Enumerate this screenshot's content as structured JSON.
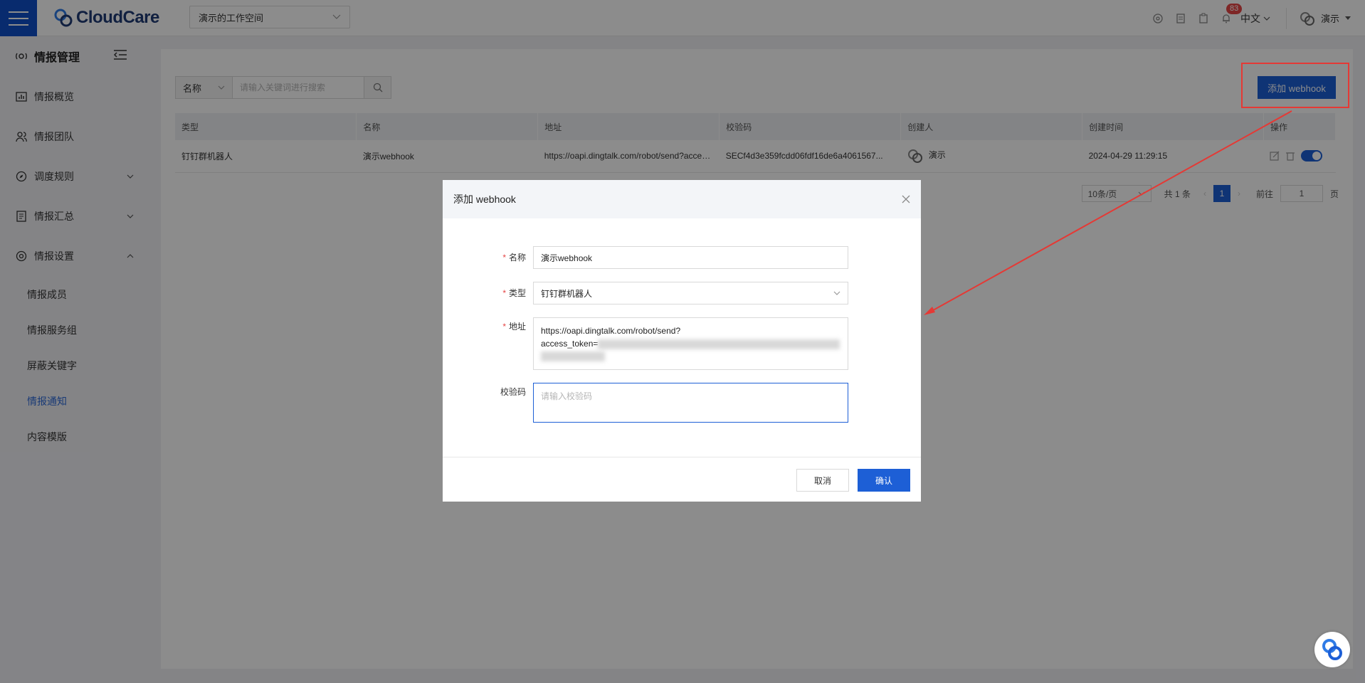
{
  "header": {
    "brand": "CloudCare",
    "workspace": "演示的工作空间",
    "notification_count": "83",
    "language": "中文",
    "user_name": "演示"
  },
  "sidebar": {
    "title": "情报管理",
    "items": [
      {
        "label": "情报概览"
      },
      {
        "label": "情报团队"
      },
      {
        "label": "调度规则"
      },
      {
        "label": "情报汇总"
      },
      {
        "label": "情报设置"
      }
    ],
    "sub_items": [
      {
        "label": "情报成员"
      },
      {
        "label": "情报服务组"
      },
      {
        "label": "屏蔽关键字"
      },
      {
        "label": "情报通知"
      },
      {
        "label": "内容模版"
      }
    ]
  },
  "toolbar": {
    "search_field": "名称",
    "search_placeholder": "请输入关键词进行搜索",
    "add_button": "添加 webhook"
  },
  "table": {
    "columns": [
      "类型",
      "名称",
      "地址",
      "校验码",
      "创建人",
      "创建时间",
      "操作"
    ],
    "rows": [
      {
        "type": "钉钉群机器人",
        "name": "演示webhook",
        "address": "https://oapi.dingtalk.com/robot/send?access_token=...",
        "secret": "SECf4d3e359fcdd06fdf16de6a4061567...",
        "creator": "演示",
        "created_at": "2024-04-29 11:29:15"
      }
    ]
  },
  "pager": {
    "page_size": "10条/页",
    "total": "共 1 条",
    "current": "1",
    "goto_label": "前往",
    "goto_value": "1",
    "page_suffix": "页"
  },
  "modal": {
    "title": "添加 webhook",
    "name_label": "名称",
    "name_value": "演示webhook",
    "type_label": "类型",
    "type_value": "钉钉群机器人",
    "address_label": "地址",
    "address_line1": "https://oapi.dingtalk.com/robot/send?",
    "address_line2": "access_token=",
    "secret_label": "校验码",
    "secret_placeholder": "请输入校验码",
    "cancel": "取消",
    "confirm": "确认"
  },
  "colors": {
    "primary": "#1d5fd6",
    "annotation": "#e53935"
  }
}
